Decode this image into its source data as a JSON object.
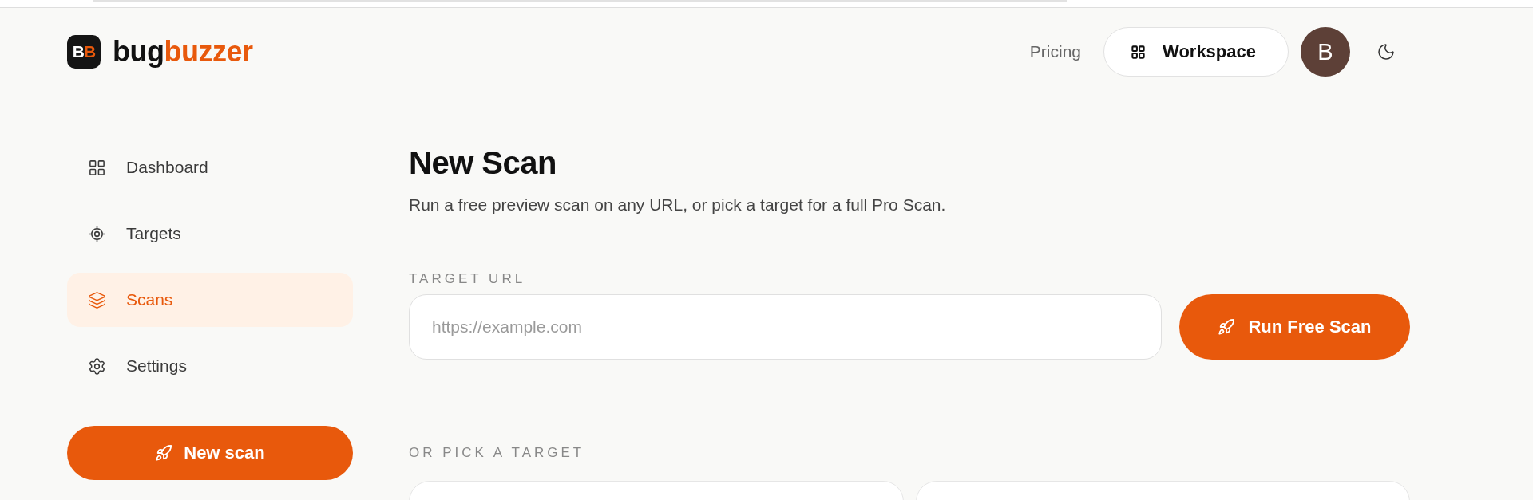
{
  "brand": {
    "mark": [
      {
        "text": "B",
        "kind": "plain"
      },
      {
        "text": "B",
        "kind": "accent"
      }
    ],
    "name": [
      {
        "text": "bug",
        "kind": "plain"
      },
      {
        "text": "buzzer",
        "kind": "accent"
      }
    ]
  },
  "header": {
    "links": [
      {
        "label": "Pricing"
      }
    ],
    "workspace_button": "Workspace",
    "avatar": "B"
  },
  "sidebar": {
    "items": [
      {
        "label": "Dashboard",
        "kind": "grid",
        "selected": false
      },
      {
        "label": "Targets",
        "kind": "target",
        "selected": false
      },
      {
        "label": "Scans",
        "kind": "layers",
        "selected": true
      },
      {
        "label": "Settings",
        "kind": "gear",
        "selected": false
      }
    ],
    "new_scan_button": "New scan"
  },
  "page": {
    "title": "New Scan",
    "subtitle": "Run a free preview scan on any URL, or pick a target for a full Pro Scan.",
    "url_field": {
      "label": "TARGET URL",
      "placeholder": "https://example.com"
    },
    "run_button": "Run Free Scan",
    "pick_label": "OR PICK A TARGET"
  }
}
